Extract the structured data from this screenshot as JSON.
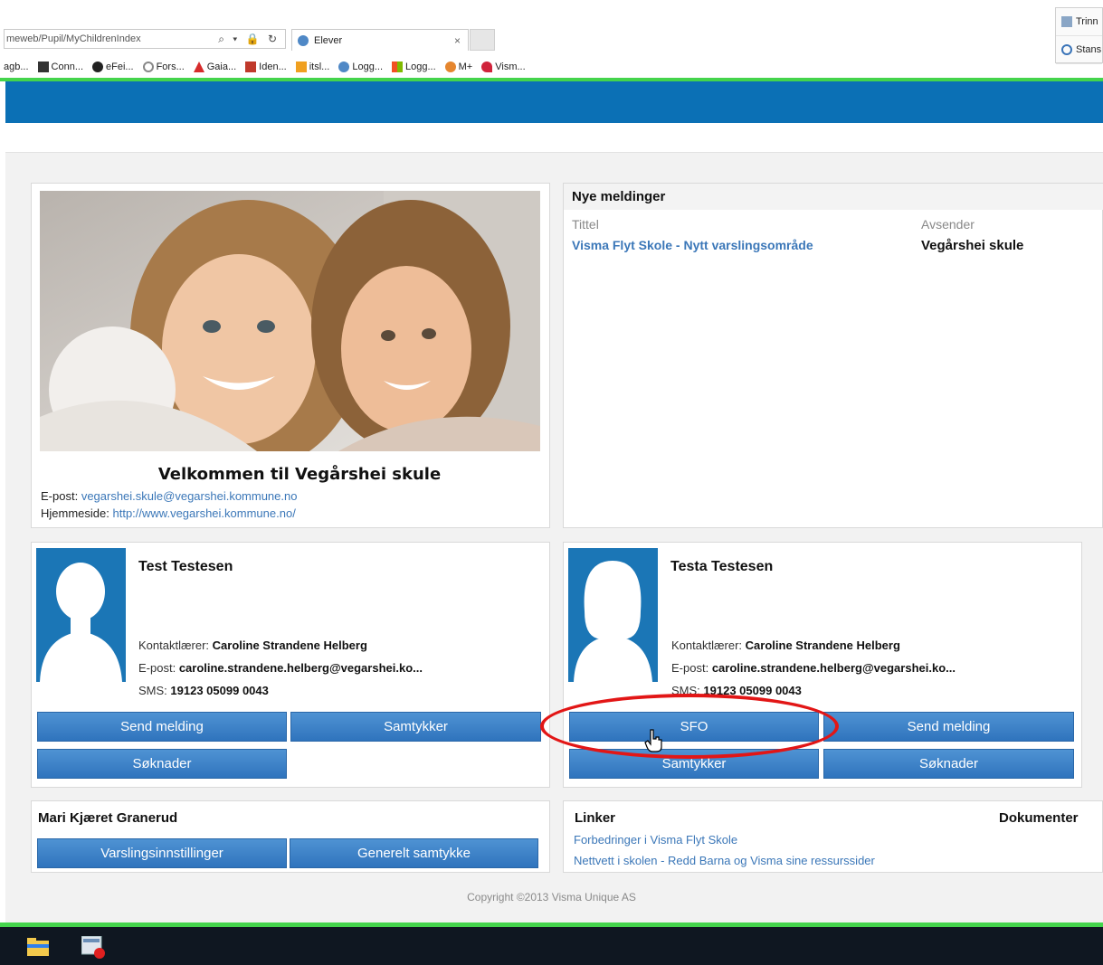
{
  "browser": {
    "address": "meweb/Pupil/MyChildrenIndex",
    "address_controls": "⌕ ▾ 🔒 ↻",
    "tab_title": "Elever",
    "tab_close": "×",
    "favorites": [
      {
        "label": "agb...",
        "icon": "bookmark-icon",
        "color": "#ffffff"
      },
      {
        "label": "Conn...",
        "icon": "connect-icon",
        "color": "#333333"
      },
      {
        "label": "eFei...",
        "icon": "efeide-icon",
        "color": "#222222"
      },
      {
        "label": "Fors...",
        "icon": "gear-flower-icon",
        "color": "#888888"
      },
      {
        "label": "Gaia...",
        "icon": "gaia-icon",
        "color": "#d62b2b"
      },
      {
        "label": "Iden...",
        "icon": "identity-icon",
        "color": "#c0392b"
      },
      {
        "label": "itsl...",
        "icon": "itslearning-icon",
        "color": "#f0a020"
      },
      {
        "label": "Logg...",
        "icon": "logon-icon",
        "color": "#4f88c6"
      },
      {
        "label": "Logg...",
        "icon": "windows-icon",
        "color": "#f25022"
      },
      {
        "label": "M+",
        "icon": "mplus-icon",
        "color": "#e5862f"
      },
      {
        "label": "Vism...",
        "icon": "visma-icon",
        "color": "#d0233b"
      }
    ],
    "side_popup": [
      {
        "label": "Trinn",
        "icon": "steps-icon"
      },
      {
        "label": "Stans",
        "icon": "pause-icon"
      }
    ]
  },
  "colors": {
    "header_blue": "#0b70b5",
    "accent_green": "#44d44c",
    "link_blue": "#3b77b8",
    "button_blue": "#3a80c8",
    "highlight_red": "#e21616"
  },
  "welcome": {
    "title": "Velkommen til Vegårshei skule",
    "email_label": "E-post:",
    "email": "vegarshei.skule@vegarshei.kommune.no",
    "homepage_label": "Hjemmeside:",
    "homepage": "http://www.vegarshei.kommune.no/"
  },
  "messages": {
    "heading": "Nye meldinger",
    "col_title": "Tittel",
    "col_sender": "Avsender",
    "items": [
      {
        "title": "Visma Flyt Skole - Nytt varslingsområde",
        "sender": "Vegårshei skule"
      }
    ]
  },
  "students": [
    {
      "name": "Test Testesen",
      "teacher_label": "Kontaktlærer:",
      "teacher": "Caroline Strandene Helberg",
      "email_label": "E-post:",
      "email": "caroline.strandene.helberg@vegarshei.ko...",
      "sms_label": "SMS:",
      "sms": "19123 05099 0043",
      "buttons": [
        "Send melding",
        "Samtykker",
        "Søknader"
      ]
    },
    {
      "name": "Testa Testesen",
      "teacher_label": "Kontaktlærer:",
      "teacher": "Caroline Strandene Helberg",
      "email_label": "E-post:",
      "email": "caroline.strandene.helberg@vegarshei.ko...",
      "sms_label": "SMS:",
      "sms": "19123 05099 0043",
      "buttons": [
        "SFO",
        "Send melding",
        "Samtykker",
        "Søknader"
      ]
    }
  ],
  "guardian": {
    "name": "Mari Kjæret Granerud",
    "buttons": [
      "Varslingsinnstillinger",
      "Generelt samtykke"
    ]
  },
  "links": {
    "heading": "Linker",
    "documents_heading": "Dokumenter",
    "items": [
      "Forbedringer i Visma Flyt Skole",
      "Nettvett i skolen - Redd Barna og Visma sine ressurssider"
    ]
  },
  "footer": {
    "copyright": "Copyright ©2013 Visma Unique AS"
  }
}
